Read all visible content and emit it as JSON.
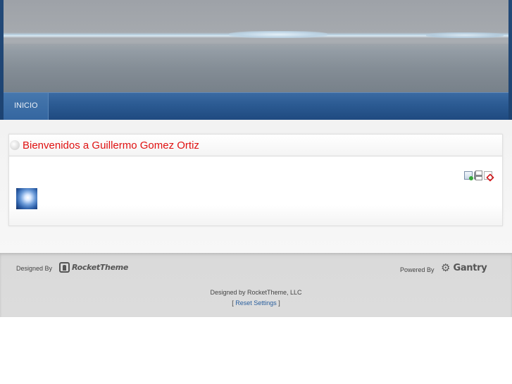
{
  "nav": {
    "items": [
      {
        "label": "INICIO"
      }
    ]
  },
  "article": {
    "title": "Bienvenidos a Guillermo Gomez Ortiz"
  },
  "tools": [
    {
      "icon": "email-icon"
    },
    {
      "icon": "print-icon"
    },
    {
      "icon": "pdf-icon"
    }
  ],
  "footer": {
    "designed_by_label": "Designed By",
    "rocket_logo_text": "RocketTheme",
    "powered_by_label": "Powered By",
    "gantry_logo_text": "Gantry",
    "copyright": "Designed by RocketTheme, LLC",
    "reset_open": "[",
    "reset_link": "Reset Settings",
    "reset_close": "]"
  },
  "colors": {
    "title_red": "#e01111",
    "nav_blue": "#2b5a92",
    "link_blue": "#2a5f9e"
  }
}
